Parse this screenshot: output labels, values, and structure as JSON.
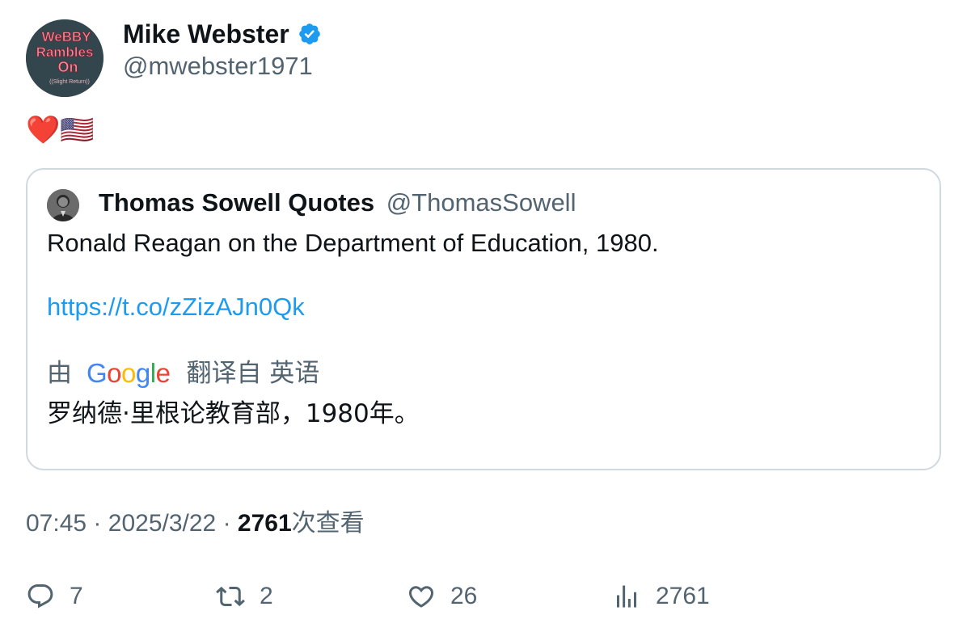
{
  "author": {
    "name": "Mike Webster",
    "handle": "@mwebster1971",
    "avatar_text": [
      "WeBBY",
      "Rambles",
      "On",
      "((Slight Return))"
    ],
    "verified": true
  },
  "tweet": {
    "text": "❤️🇺🇸"
  },
  "quote": {
    "name": "Thomas Sowell Quotes",
    "handle": "@ThomasSowell",
    "text": "Ronald Reagan on the Department of Education, 1980.",
    "link": "https://t.co/zZizAJn0Qk",
    "translate_prefix": "由",
    "translate_brand": "Google",
    "translate_suffix": "翻译自 英语",
    "translated_text": "罗纳德·里根论教育部，1980年。"
  },
  "meta": {
    "time": "07:45",
    "sep1": "·",
    "date": "2025/3/22",
    "sep2": "·",
    "views_count": "2761",
    "views_label": "次查看"
  },
  "actions": {
    "replies": "7",
    "reposts": "2",
    "likes": "26",
    "views": "2761"
  },
  "colors": {
    "text_primary": "#0f1419",
    "text_secondary": "#536471",
    "link": "#1d9bf0",
    "border": "#cfd9de",
    "verified": "#1d9bf0"
  }
}
